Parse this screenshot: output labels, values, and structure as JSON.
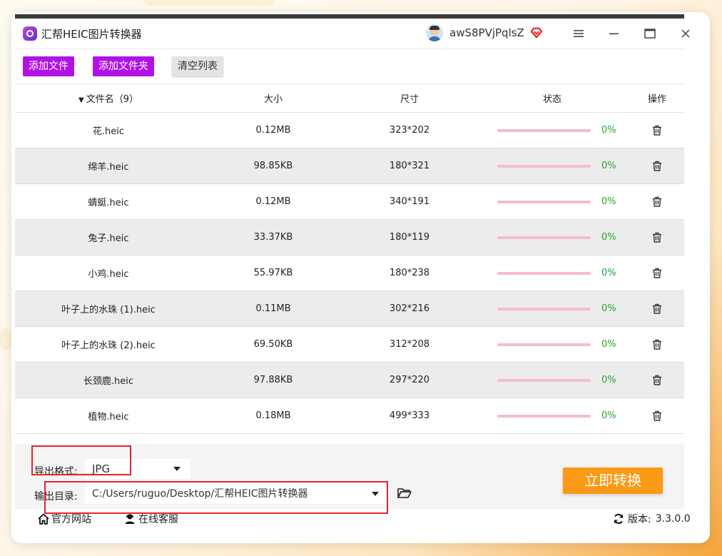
{
  "app": {
    "title": "汇帮HEIC图片转换器",
    "username": "awS8PVjPqlsZ"
  },
  "toolbar": {
    "add_file": "添加文件",
    "add_folder": "添加文件夹",
    "clear_list": "清空列表"
  },
  "table": {
    "headers": {
      "name": "文件名（9）",
      "size": "大小",
      "dimensions": "尺寸",
      "status": "状态",
      "action": "操作"
    },
    "rows": [
      {
        "name": "花.heic",
        "size": "0.12MB",
        "dim": "323*202",
        "progress": "0%"
      },
      {
        "name": "绵羊.heic",
        "size": "98.85KB",
        "dim": "180*321",
        "progress": "0%"
      },
      {
        "name": "蜻蜓.heic",
        "size": "0.12MB",
        "dim": "340*191",
        "progress": "0%"
      },
      {
        "name": "兔子.heic",
        "size": "33.37KB",
        "dim": "180*119",
        "progress": "0%"
      },
      {
        "name": "小鸡.heic",
        "size": "55.97KB",
        "dim": "180*238",
        "progress": "0%"
      },
      {
        "name": "叶子上的水珠 (1).heic",
        "size": "0.11MB",
        "dim": "302*216",
        "progress": "0%"
      },
      {
        "name": "叶子上的水珠 (2).heic",
        "size": "69.50KB",
        "dim": "312*208",
        "progress": "0%"
      },
      {
        "name": "长颈鹿.heic",
        "size": "97.88KB",
        "dim": "297*220",
        "progress": "0%"
      },
      {
        "name": "植物.heic",
        "size": "0.18MB",
        "dim": "499*333",
        "progress": "0%"
      }
    ]
  },
  "output": {
    "format_label": "导出格式:",
    "format_value": "JPG",
    "dir_label": "输出目录:",
    "dir_value": "C:/Users/ruguo/Desktop/汇帮HEIC图片转换器",
    "convert_button": "立即转换"
  },
  "footer": {
    "website": "官方网站",
    "support": "在线客服",
    "version_label": "版本:",
    "version_value": "3.3.0.0"
  },
  "colors": {
    "accent_purple": "#b012e6",
    "convert_orange": "#fb9a16",
    "progress_track": "#f5bcd0",
    "progress_text": "#22a33a",
    "highlight_red": "#e8232b"
  }
}
